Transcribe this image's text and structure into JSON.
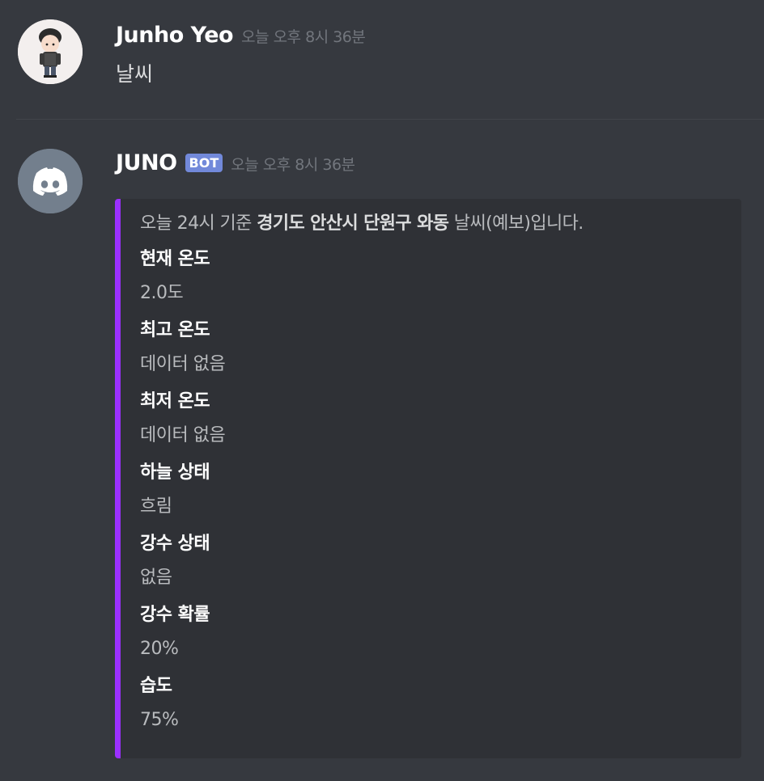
{
  "messages": [
    {
      "username": "Junho Yeo",
      "timestamp": "오늘 오후 8시 36분",
      "content": "날씨"
    },
    {
      "username": "JUNO",
      "tag": "BOT",
      "timestamp": "오늘 오후 8시 36분",
      "embed": {
        "accent_color": "#9b30ff",
        "description": {
          "prefix": "오늘 24시 기준 ",
          "location": "경기도 안산시 단원구 와동",
          "suffix": " 날씨(예보)입니다."
        },
        "fields": [
          {
            "name": "현재 온도",
            "value": "2.0도"
          },
          {
            "name": "최고 온도",
            "value": "데이터 없음"
          },
          {
            "name": "최저 온도",
            "value": "데이터 없음"
          },
          {
            "name": "하늘 상태",
            "value": "흐림"
          },
          {
            "name": "강수 상태",
            "value": "없음"
          },
          {
            "name": "강수 확률",
            "value": "20%"
          },
          {
            "name": "습도",
            "value": "75%"
          }
        ]
      }
    }
  ],
  "icons": {
    "user_avatar": "chibi-person-avatar",
    "bot_avatar": "discord-logo-icon"
  }
}
